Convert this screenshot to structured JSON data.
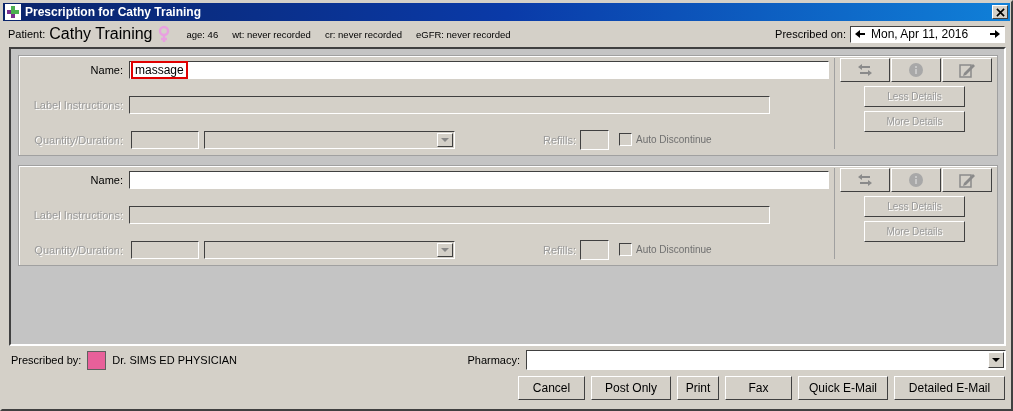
{
  "window": {
    "title": "Prescription for Cathy Training"
  },
  "patient": {
    "label": "Patient:",
    "name": "Cathy Training",
    "info": [
      "age: 46",
      "wt: never recorded",
      "cr: never recorded",
      "eGFR: never recorded"
    ]
  },
  "prescribed_on": {
    "label": "Prescribed on:",
    "value": "Mon, Apr 11, 2016"
  },
  "prescriptions": [
    {
      "name_label": "Name:",
      "name_value": "massage",
      "name_highlighted": true,
      "instructions_label": "Label Instructions:",
      "quantity_label": "Quantity/Duration:",
      "refills_label": "Refills:",
      "details_disabled": true,
      "auto_discontinue": {
        "label": "Auto Discontinue",
        "checked": false
      },
      "buttons": [
        "Less Details",
        "More Details"
      ]
    },
    {
      "name_label": "Name:",
      "instructions_label": "Label Instructions:",
      "quantity_label": "Quantity/Duration:",
      "refills_label": "Refills:",
      "details_disabled": true,
      "auto_discontinue": {
        "label": "Auto Discontinue",
        "checked": false
      },
      "buttons": [
        "Less Details",
        "More Details"
      ]
    }
  ],
  "footer": {
    "prescribed_by_label": "Prescribed by:",
    "prescriber": {
      "name": "Dr. SIMS ED PHYSICIAN",
      "color": "#e8609a"
    },
    "pharmacy_label": "Pharmacy:"
  },
  "buttons": [
    "Cancel",
    "Post Only",
    "Print",
    "Fax",
    "Quick E-Mail",
    "Detailed E-Mail"
  ]
}
